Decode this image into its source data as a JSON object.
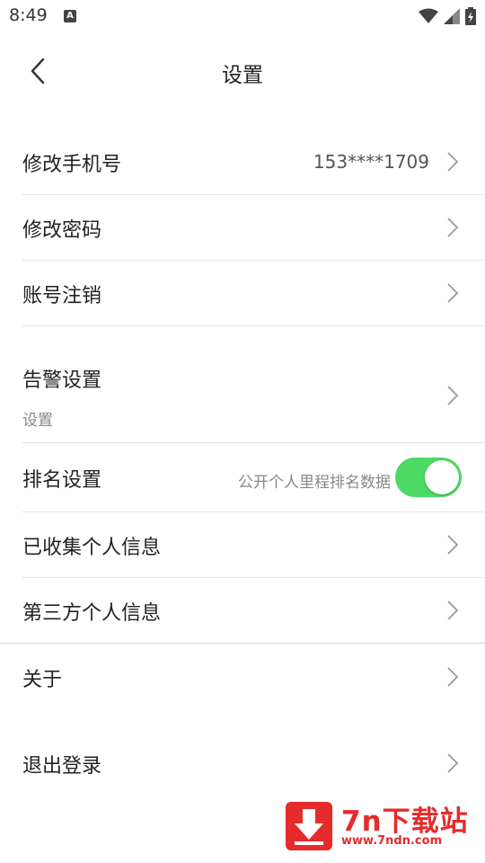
{
  "status": {
    "time": "8:49",
    "a_icon": "A"
  },
  "header": {
    "title": "设置"
  },
  "rows": {
    "phone": {
      "label": "修改手机号",
      "value": "153****1709"
    },
    "password": {
      "label": "修改密码"
    },
    "cancel_account": {
      "label": "账号注销"
    },
    "alarm": {
      "label": "告警设置",
      "sub": "设置"
    },
    "ranking": {
      "label": "排名设置",
      "hint": "公开个人里程排名数据",
      "toggle_on": true
    },
    "collected_info": {
      "label": "已收集个人信息"
    },
    "third_party": {
      "label": "第三方个人信息"
    },
    "about": {
      "label": "关于"
    },
    "logout": {
      "label": "退出登录"
    }
  },
  "watermark": {
    "title": "7n下载站",
    "url": "www.7ndn.com"
  },
  "colors": {
    "toggle_on": "#4cd964",
    "watermark": "#e52b2b"
  },
  "icons": [
    "back-arrow-icon",
    "chevron-right-icon",
    "wifi-icon",
    "signal-icon",
    "battery-icon",
    "download-icon"
  ]
}
